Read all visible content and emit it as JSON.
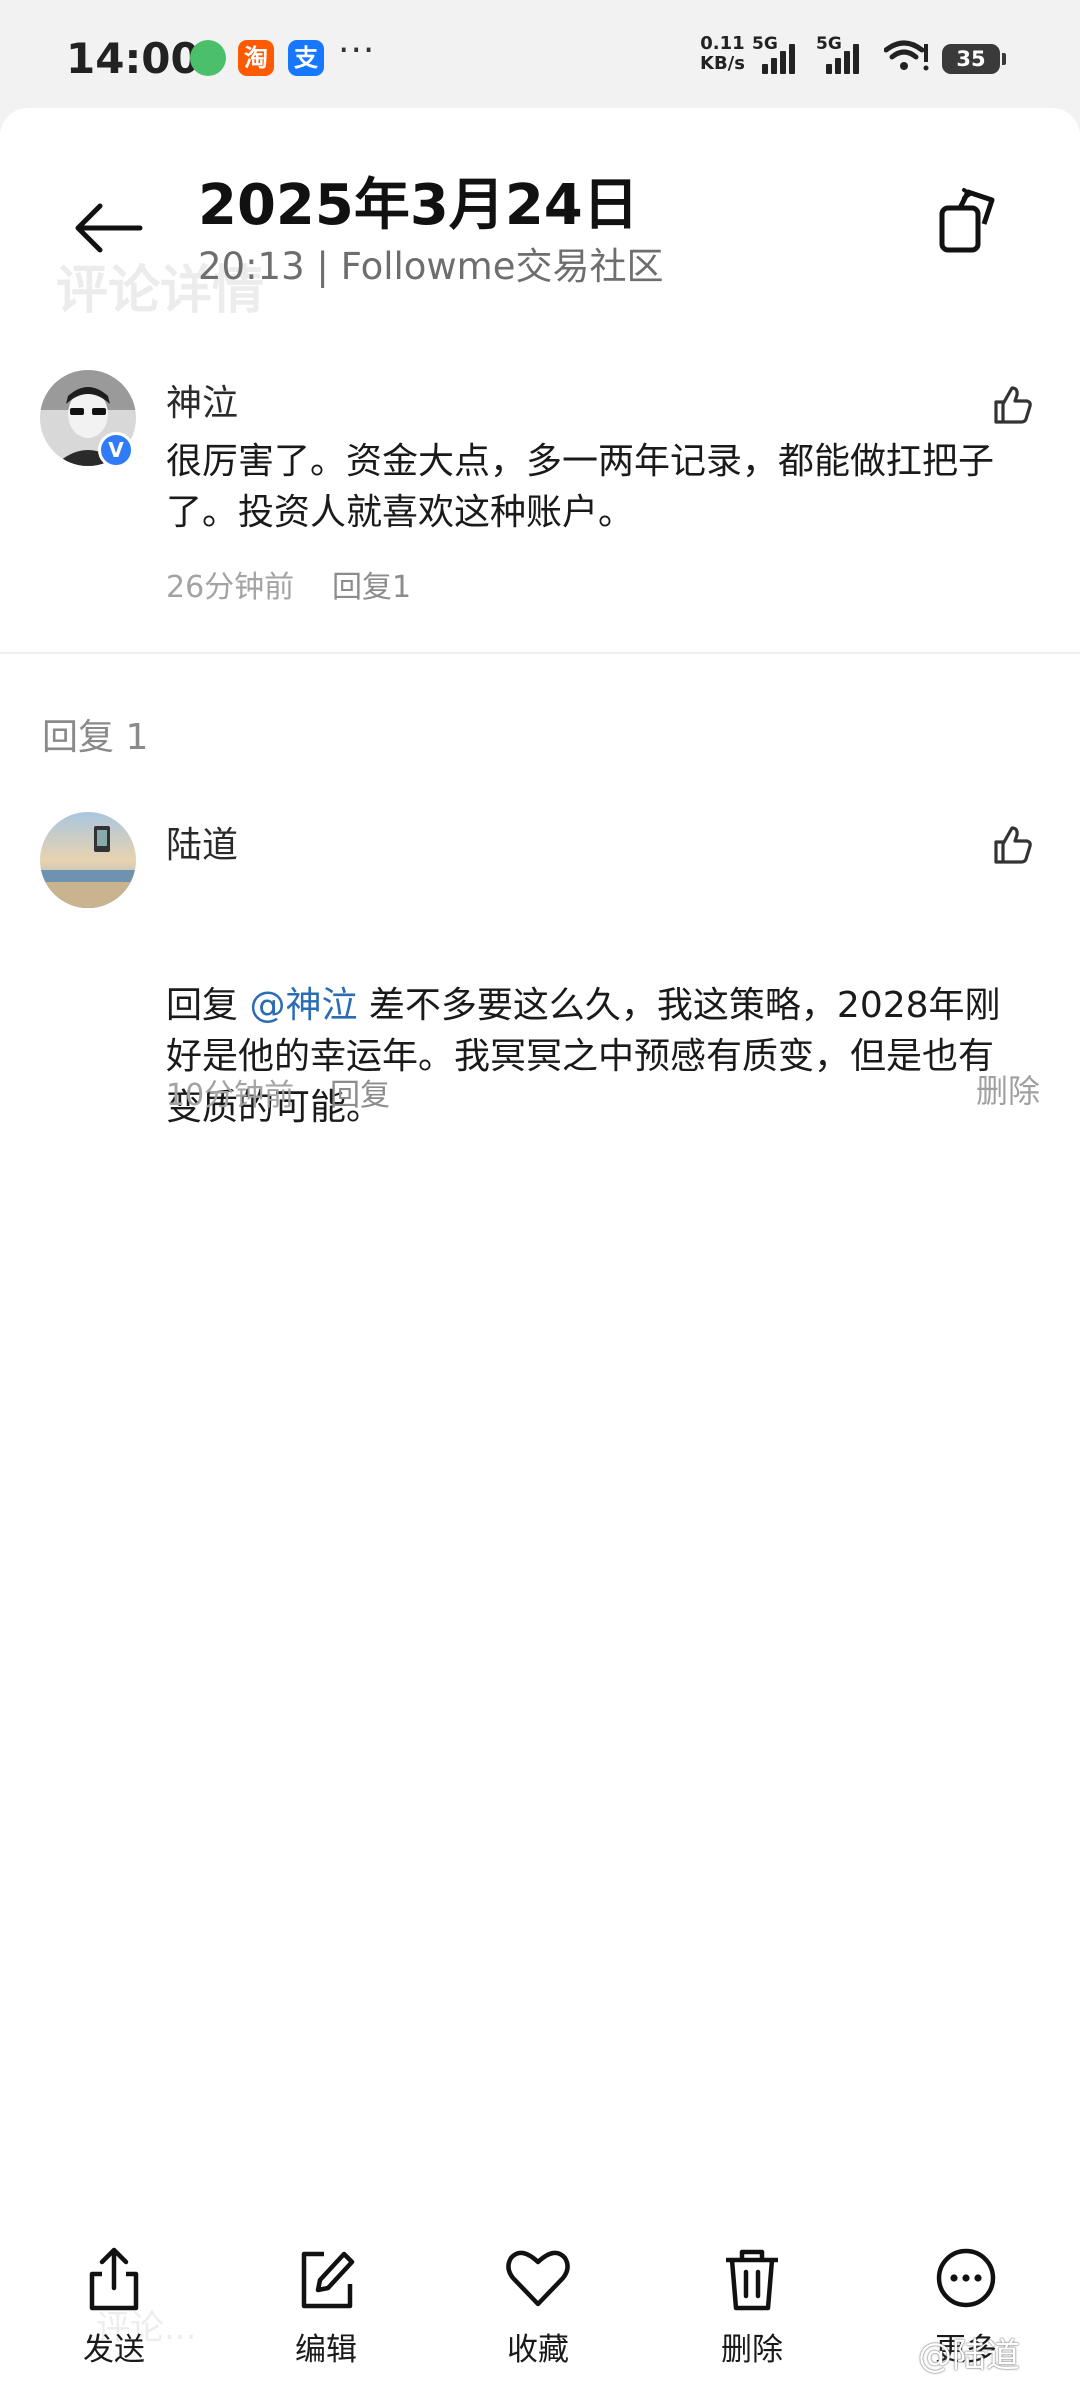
{
  "status_bar": {
    "time": "14:00",
    "apps": [
      {
        "icon": "green-leaf-app-icon",
        "glyph": "",
        "color": "#4cbf6a"
      },
      {
        "icon": "taobao-app-icon",
        "glyph": "淘",
        "color": "#ff5a00"
      },
      {
        "icon": "alipay-app-icon",
        "glyph": "支",
        "color": "#1677ff"
      }
    ],
    "more": "···",
    "net_speed_value": "0.11",
    "net_speed_unit": "KB/s",
    "sim1_label": "5G",
    "sim2_label": "5G",
    "battery": "35"
  },
  "header": {
    "ghost_title": "评论详情",
    "date": "2025年3月24日",
    "subtitle": "20:13 | Followme交易社区"
  },
  "main_comment": {
    "author": "神泣",
    "verified_mark": "V",
    "text": "很厉害了。资金大点，多一两年记录，都能做扛把子了。投资人就喜欢这种账户。",
    "time": "26分钟前",
    "reply_label": "回复1"
  },
  "replies_section": {
    "label": "回复 1"
  },
  "reply": {
    "author": "陆道",
    "prefix": "回复 ",
    "mention": "@神泣",
    "text": " 差不多要这么久，我这策略，2028年刚好是他的幸运年。我冥冥之中预感有质变，但是也有变质的可能。",
    "time": "10分钟前",
    "reply_label": "回复",
    "delete_label": "删除"
  },
  "toolbar": {
    "items": [
      {
        "icon": "share-icon",
        "label": "发送"
      },
      {
        "icon": "edit-icon",
        "label": "编辑"
      },
      {
        "icon": "heart-icon",
        "label": "收藏"
      },
      {
        "icon": "trash-icon",
        "label": "删除"
      },
      {
        "icon": "more-icon",
        "label": "更多"
      }
    ]
  },
  "ghost_bottom": "评论...",
  "watermark": "@陆道"
}
